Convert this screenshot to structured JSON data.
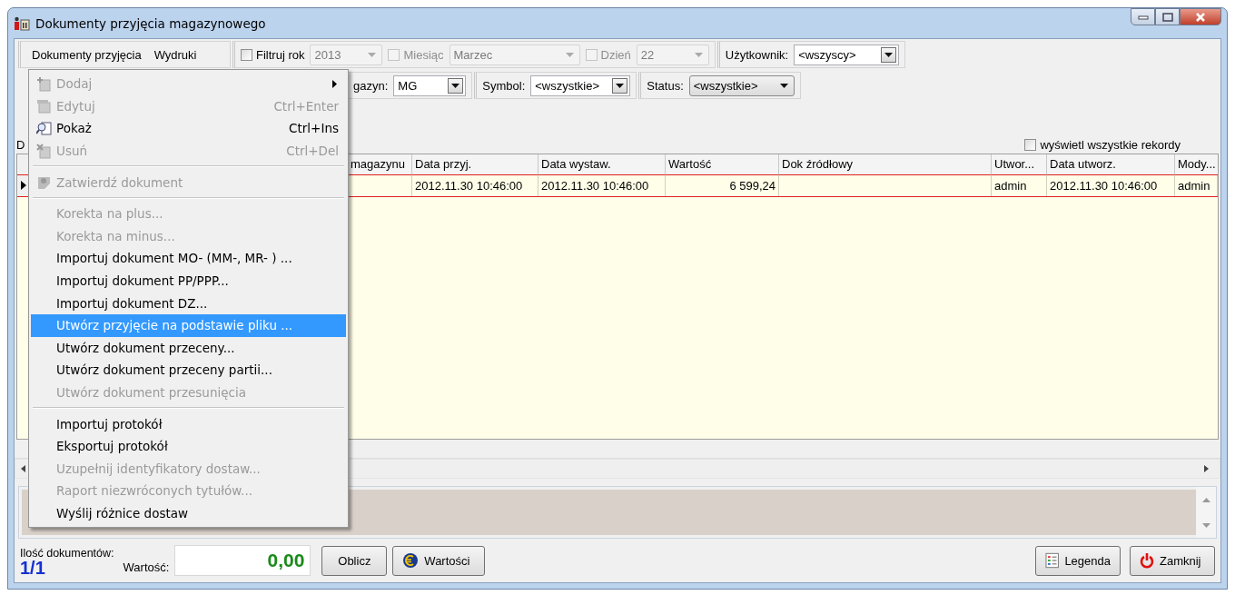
{
  "window": {
    "title": "Dokumenty przyjęcia magazynowego"
  },
  "menubar": [
    {
      "label": "Dokumenty przyjęcia"
    },
    {
      "label": "Wydruki"
    }
  ],
  "toolbar_row_1": [
    [
      {
        "kind": "check",
        "label": "Filtruj rok",
        "checked": false,
        "disabled": false
      },
      {
        "kind": "combo",
        "value": "2013",
        "disabled": true
      },
      {
        "kind": "check",
        "label": "Miesiąc",
        "checked": false,
        "disabled": true
      },
      {
        "kind": "combo",
        "value": "Marzec",
        "disabled": true
      },
      {
        "kind": "check",
        "label": "Dzień",
        "checked": false,
        "disabled": true
      },
      {
        "kind": "combo",
        "value": "22",
        "disabled": true
      }
    ],
    [
      {
        "kind": "label",
        "text": "Użytkownik:"
      },
      {
        "kind": "combo",
        "value": "<wszyscy>",
        "disabled": false
      }
    ]
  ],
  "toolbar_row_2": [
    [
      {
        "kind": "label",
        "text": "gazyn:"
      },
      {
        "kind": "combo",
        "value": "MG",
        "disabled": false
      }
    ],
    [
      {
        "kind": "label",
        "text": "Symbol:"
      },
      {
        "kind": "combo",
        "value": "<wszystkie>",
        "disabled": false
      }
    ],
    [
      {
        "kind": "label",
        "text": "Status:"
      },
      {
        "kind": "flatcombo",
        "value": "<wszystkie>",
        "disabled": false
      }
    ]
  ],
  "section_label": "D",
  "show_all_records": {
    "label": "wyświetl wszystkie rekordy",
    "checked": false
  },
  "table": {
    "columns": [
      "magazynu",
      "Data przyj.",
      "Data wystaw.",
      "Wartość",
      "Dok źródłowy",
      "Utwor...",
      "Data utworz.",
      "Mody..."
    ],
    "rows": [
      {
        "current": true,
        "cells": [
          "",
          "2012.11.30 10:46:00",
          "2012.11.30 10:46:00",
          "6 599,24",
          "",
          "admin",
          "2012.11.30 10:46:00",
          "admin"
        ]
      }
    ]
  },
  "menu": [
    {
      "kind": "add",
      "label": "Dodaj",
      "disabled": true,
      "submenu": true,
      "selected": false
    },
    {
      "kind": "edit",
      "label": "Edytuj",
      "shortcut": "Ctrl+Enter",
      "disabled": true,
      "selected": false
    },
    {
      "kind": "view",
      "label": "Pokaż",
      "shortcut": "Ctrl+Ins",
      "disabled": false,
      "selected": false
    },
    {
      "kind": "delete",
      "label": "Usuń",
      "shortcut": "Ctrl+Del",
      "disabled": true,
      "selected": false
    },
    {
      "kind": "separator"
    },
    {
      "kind": "approve",
      "label": "Zatwierdź dokument",
      "disabled": true,
      "selected": false
    },
    {
      "kind": "separator"
    },
    {
      "kind": "item",
      "label": "Korekta na plus...",
      "disabled": true,
      "selected": false
    },
    {
      "kind": "item",
      "label": "Korekta na minus...",
      "disabled": true,
      "selected": false
    },
    {
      "kind": "item",
      "label": "Importuj dokument MO- (MM-, MR- ) ...",
      "disabled": false,
      "selected": false
    },
    {
      "kind": "item",
      "label": "Importuj dokument PP/PPP...",
      "disabled": false,
      "selected": false
    },
    {
      "kind": "item",
      "label": "Importuj dokument DZ...",
      "disabled": false,
      "selected": false
    },
    {
      "kind": "item",
      "label": "Utwórz przyjęcie na podstawie pliku ...",
      "disabled": false,
      "selected": true
    },
    {
      "kind": "item",
      "label": "Utwórz dokument przeceny...",
      "disabled": false,
      "selected": false
    },
    {
      "kind": "item",
      "label": "Utwórz dokument przeceny partii...",
      "disabled": false,
      "selected": false
    },
    {
      "kind": "item",
      "label": "Utwórz dokument przesunięcia",
      "disabled": true,
      "selected": false
    },
    {
      "kind": "separator"
    },
    {
      "kind": "item",
      "label": "Importuj protokół",
      "disabled": false,
      "selected": false
    },
    {
      "kind": "item",
      "label": "Eksportuj protokół",
      "disabled": false,
      "selected": false
    },
    {
      "kind": "item",
      "label": "Uzupełnij identyfikatory dostaw...",
      "disabled": true,
      "selected": false
    },
    {
      "kind": "item",
      "label": "Raport niezwróconych tytułów...",
      "disabled": true,
      "selected": false
    },
    {
      "kind": "item",
      "label": "Wyślij różnice dostaw",
      "disabled": false,
      "selected": false
    }
  ],
  "footer": {
    "count_label": "Ilość dokumentów:",
    "count": "1/1",
    "value_label": "Wartość:",
    "value": "0,00",
    "buttons_left": [
      {
        "kind": "plain",
        "label": "Oblicz"
      },
      {
        "kind": "coin",
        "label": "Wartości"
      }
    ],
    "buttons_right": [
      {
        "kind": "legend",
        "label": "Legenda"
      },
      {
        "kind": "power",
        "label": "Zamknij"
      }
    ]
  }
}
